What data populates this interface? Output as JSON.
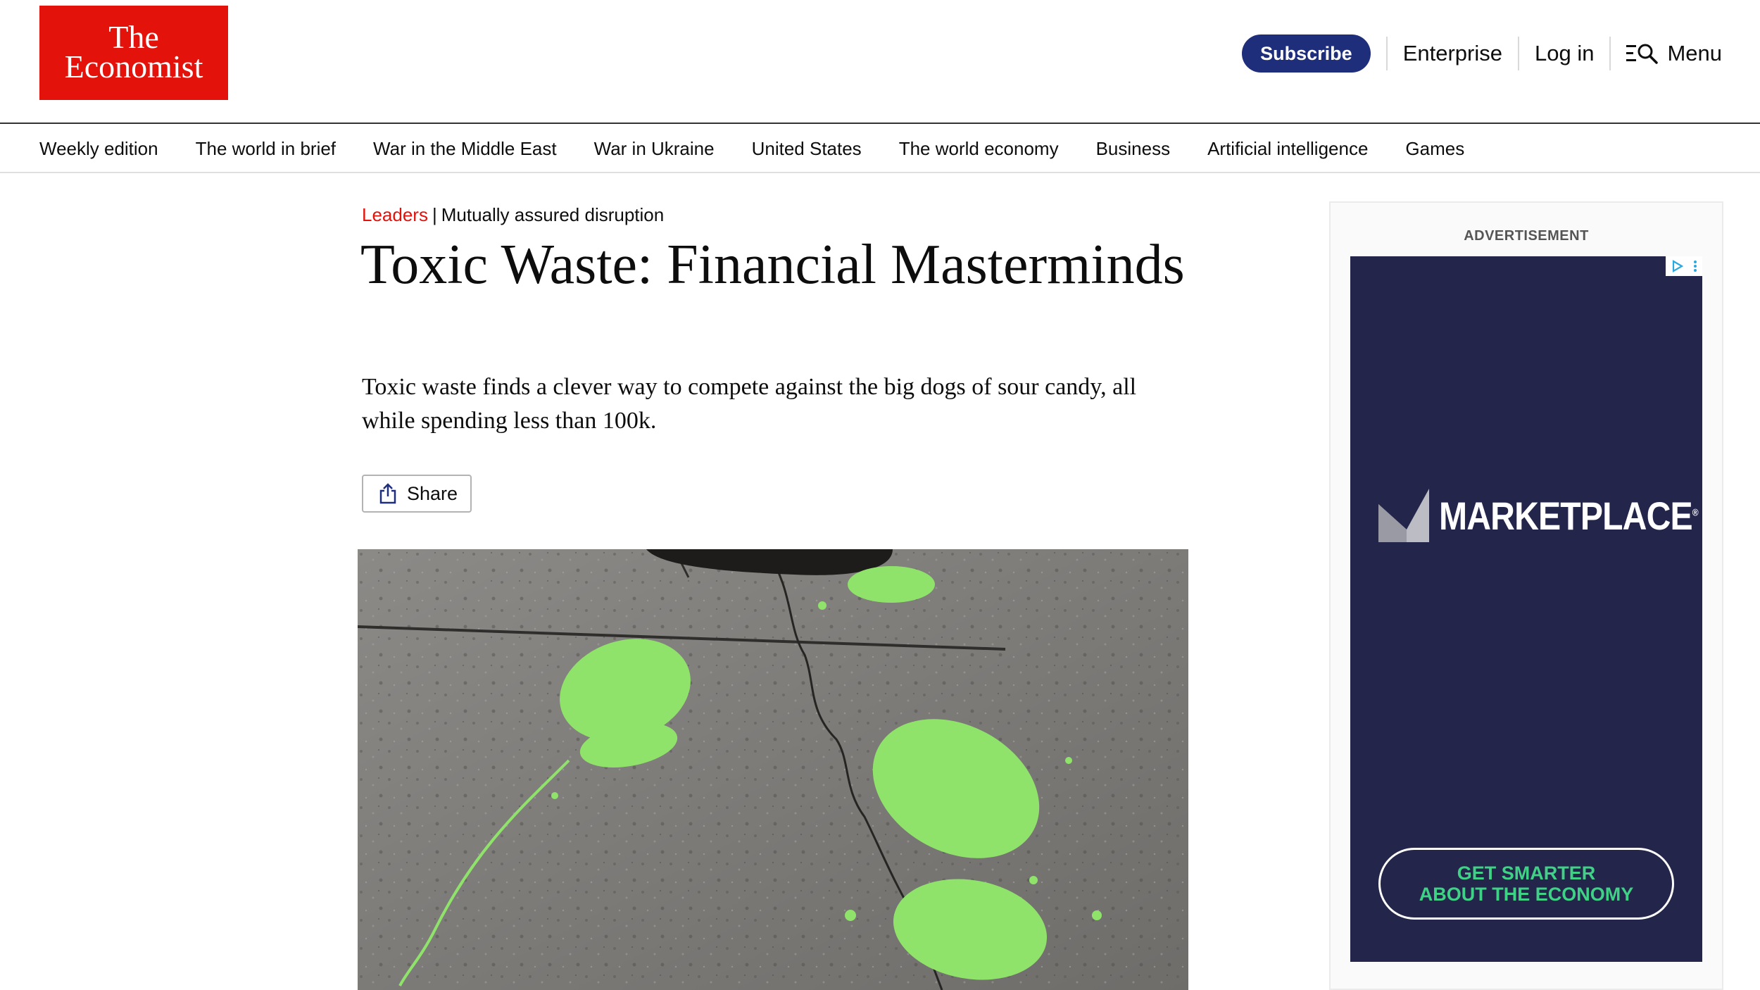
{
  "brand": {
    "logo_line1": "The",
    "logo_line2": "Economist",
    "color": "#e3120b"
  },
  "topnav": {
    "subscribe": "Subscribe",
    "enterprise": "Enterprise",
    "login": "Log in",
    "menu": "Menu",
    "subscribe_color": "#1f2e7a"
  },
  "sections": [
    "Weekly edition",
    "The world in brief",
    "War in the Middle East",
    "War in Ukraine",
    "United States",
    "The world economy",
    "Business",
    "Artificial intelligence",
    "Games"
  ],
  "article": {
    "section": "Leaders",
    "flytitle": "Mutually assured disruption",
    "headline": "Toxic Waste: Financial Masterminds",
    "standfirst": "Toxic waste finds a clever way to compete against the big dogs of sour candy, all while spending less than 100k.",
    "share": "Share",
    "image_alt": "green-paint-footprints-on-asphalt"
  },
  "advert": {
    "label": "ADVERTISEMENT",
    "logo": "MARKETPLACE",
    "logo_mark": "®",
    "cta_line1": "GET SMARTER",
    "cta_line2": "ABOUT THE ECONOMY",
    "bg_color": "#23264a",
    "cta_color": "#3fd186"
  }
}
